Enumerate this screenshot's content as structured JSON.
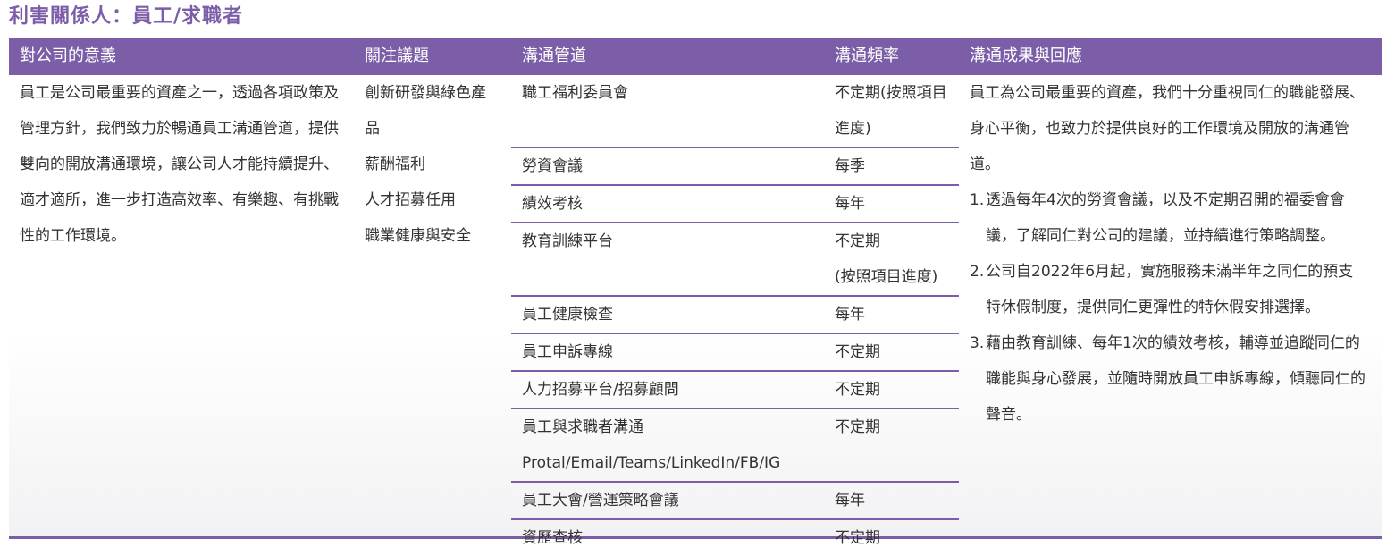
{
  "page": {
    "title": "利害關係人：員工/求職者"
  },
  "table": {
    "headers": [
      "對公司的意義",
      "關注議題",
      "溝通管道",
      "溝通頻率",
      "溝通成果與回應"
    ],
    "meaning": "員工是公司最重要的資產之一，透過各項政策及管理方針，我們致力於暢通員工溝通管道，提供雙向的開放溝通環境，讓公司人才能持續提升、適才適所，進一步打造高效率、有樂趣、有挑戰性的工作環境。",
    "topics": [
      "創新研發與綠色產品",
      "薪酬福利",
      "人才招募任用",
      "職業健康與安全"
    ],
    "channels": [
      {
        "name": "職工福利委員會",
        "freq": "不定期(按照項目進度)"
      },
      {
        "name": "勞資會議",
        "freq": "每季"
      },
      {
        "name": "績效考核",
        "freq": "每年"
      },
      {
        "name": "教育訓練平台",
        "freq": "不定期",
        "freq2": "(按照項目進度)"
      },
      {
        "name": "員工健康檢查",
        "freq": "每年"
      },
      {
        "name": "員工申訴專線",
        "freq": "不定期"
      },
      {
        "name": "人力招募平台/招募顧問",
        "freq": "不定期"
      },
      {
        "name": "員工與求職者溝通",
        "name2": "Protal/Email/Teams/LinkedIn/FB/IG",
        "freq": "不定期"
      },
      {
        "name": "員工大會/營運策略會議",
        "freq": "每年"
      },
      {
        "name": "資歷查核",
        "freq": "不定期"
      }
    ],
    "results": {
      "intro": "員工為公司最重要的資產，我們十分重視同仁的職能發展、身心平衡，也致力於提供良好的工作環境及開放的溝通管道。",
      "items": [
        {
          "num": "1.",
          "text": "透過每年4次的勞資會議，以及不定期召開的福委會會議，了解同仁對公司的建議，並持續進行策略調整。"
        },
        {
          "num": "2.",
          "text": "公司自2022年6月起，實施服務未滿半年之同仁的預支特休假制度，提供同仁更彈性的特休假安排選擇。"
        },
        {
          "num": "3.",
          "text": "藉由教育訓練、每年1次的績效考核，輔導並追蹤同仁的職能與身心發展，並隨時開放員工申訴專線，傾聽同仁的聲音。"
        }
      ]
    }
  }
}
